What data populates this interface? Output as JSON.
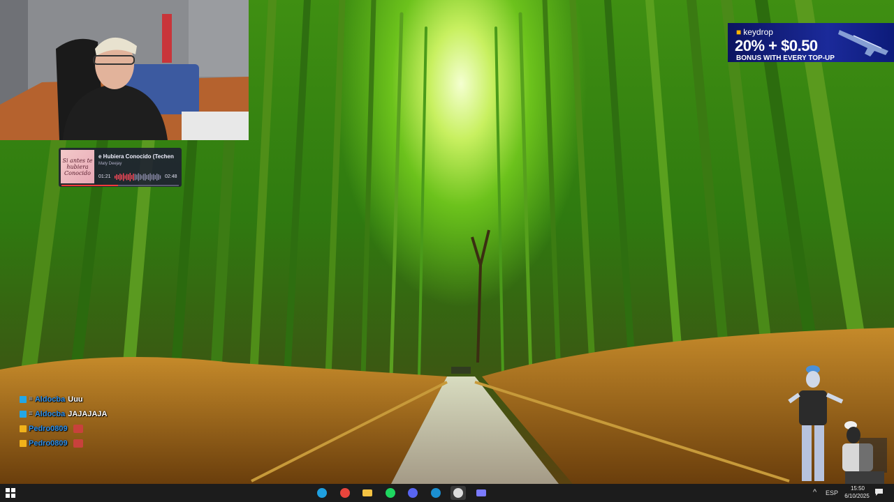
{
  "now_playing": {
    "cover_text": "Si antes te hubiera Conocido",
    "title": "e Hubiera Conocido (Techen",
    "artist": "Maty Deejay",
    "time_current": "01:21",
    "time_total": "02:48",
    "progress": 0.48
  },
  "ad": {
    "logo": "keydrop",
    "headline": "20% + $0.50",
    "subline": "BONUS WITH EVERY TOP-UP"
  },
  "chat": [
    {
      "user": "Aldocba",
      "message": "Uuu",
      "badge": "mod",
      "user_color": "#2f8fe8"
    },
    {
      "user": "Aldocba",
      "message": "JAJAJAJA",
      "badge": "mod",
      "user_color": "#2f8fe8"
    },
    {
      "user": "Pedro0809",
      "message": "",
      "badge": "sub",
      "user_color": "#2f8fe8"
    },
    {
      "user": "Pedro0809",
      "message": "",
      "badge": "sub",
      "user_color": "#2f8fe8"
    }
  ],
  "taskbar": {
    "apps": [
      {
        "name": "edge-icon",
        "color": "#1fa0e0"
      },
      {
        "name": "chrome-icon",
        "color": "#e8453c"
      },
      {
        "name": "file-explorer-icon",
        "color": "#f5c342"
      },
      {
        "name": "spotify-icon",
        "color": "#1ed760"
      },
      {
        "name": "discord-icon",
        "color": "#5865f2"
      },
      {
        "name": "steam-icon",
        "color": "#1b8fd1"
      },
      {
        "name": "obs-icon",
        "color": "#dddddd"
      },
      {
        "name": "app-grid-icon",
        "color": "#7b7bff"
      }
    ],
    "language": "ESP",
    "time": "15:50",
    "date": "6/10/2025"
  }
}
